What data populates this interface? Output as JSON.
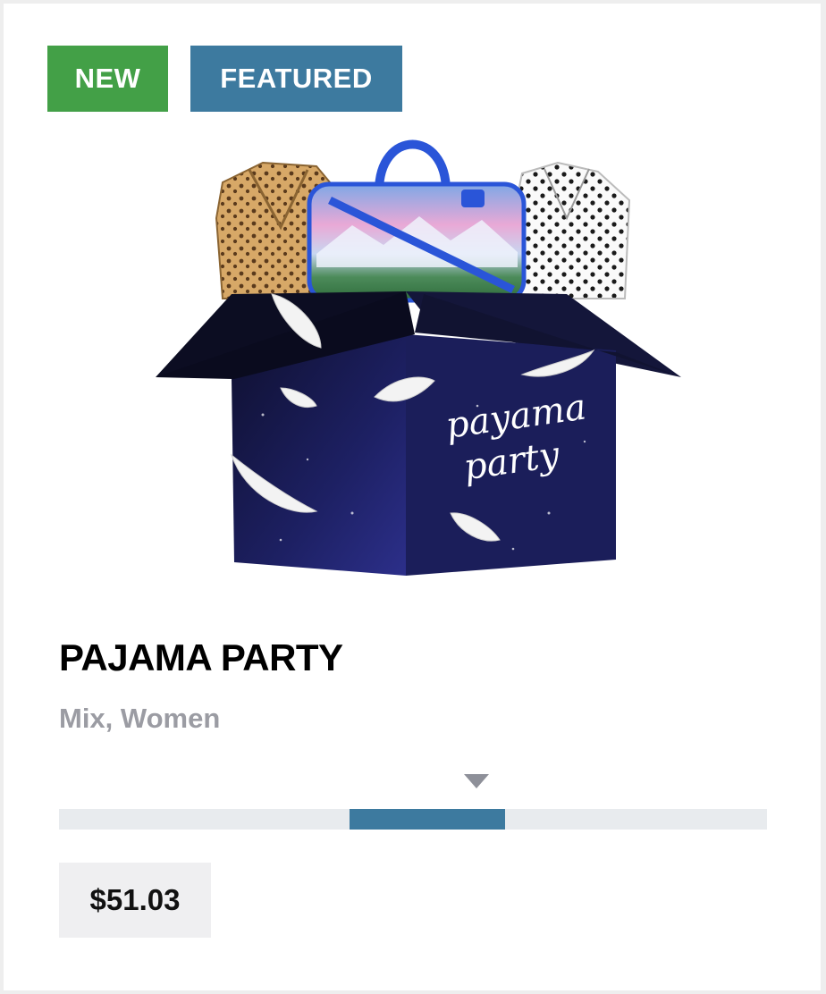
{
  "badges": {
    "new_label": "NEW",
    "featured_label": "FEATURED"
  },
  "product": {
    "title": "PAJAMA PARTY",
    "categories": "Mix, Women",
    "box_text_line1": "payama",
    "box_text_line2": "party",
    "price": "$51.03"
  },
  "range_indicator": {
    "segment_start": 0.41,
    "segment_end": 0.63,
    "marker_position": 0.59
  },
  "colors": {
    "new_badge": "#43a047",
    "featured_badge": "#3d7a9f",
    "range_fill": "#3d7a9f",
    "range_track": "#e8ebee",
    "subtitle": "#9b9ca3"
  }
}
